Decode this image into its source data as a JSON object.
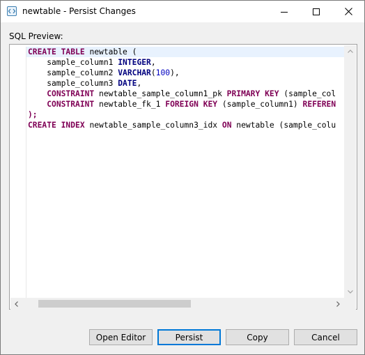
{
  "window": {
    "title": "newtable - Persist Changes"
  },
  "preview": {
    "label": "SQL Preview:"
  },
  "sql_lines": [
    [
      {
        "t": "CREATE",
        "c": "kw"
      },
      {
        "t": " "
      },
      {
        "t": "TABLE",
        "c": "kw"
      },
      {
        "t": " newtable ("
      }
    ],
    [
      {
        "t": "    sample_column1 "
      },
      {
        "t": "INTEGER",
        "c": "kwb"
      },
      {
        "t": ","
      }
    ],
    [
      {
        "t": "    sample_column2 "
      },
      {
        "t": "VARCHAR",
        "c": "kwb"
      },
      {
        "t": "("
      },
      {
        "t": "100",
        "c": "num"
      },
      {
        "t": "),"
      }
    ],
    [
      {
        "t": "    sample_column3 "
      },
      {
        "t": "DATE",
        "c": "kwb"
      },
      {
        "t": ","
      }
    ],
    [
      {
        "t": "    "
      },
      {
        "t": "CONSTRAINT",
        "c": "kw"
      },
      {
        "t": " newtable_sample_column1_pk "
      },
      {
        "t": "PRIMARY",
        "c": "kw"
      },
      {
        "t": " "
      },
      {
        "t": "KEY",
        "c": "kw"
      },
      {
        "t": " (sample_col"
      }
    ],
    [
      {
        "t": "    "
      },
      {
        "t": "CONSTRAINT",
        "c": "kw"
      },
      {
        "t": " newtable_fk_1 "
      },
      {
        "t": "FOREIGN",
        "c": "kw"
      },
      {
        "t": " "
      },
      {
        "t": "KEY",
        "c": "kw"
      },
      {
        "t": " (sample_column1) "
      },
      {
        "t": "REFEREN",
        "c": "kw"
      }
    ],
    [
      {
        "t": ");",
        "c": "kw"
      }
    ],
    [
      {
        "t": "CREATE",
        "c": "kw"
      },
      {
        "t": " "
      },
      {
        "t": "INDEX",
        "c": "kw"
      },
      {
        "t": " newtable_sample_column3_idx "
      },
      {
        "t": "ON",
        "c": "kw"
      },
      {
        "t": " newtable (sample_colu"
      }
    ]
  ],
  "buttons": {
    "open_editor": "Open Editor",
    "persist": "Persist",
    "copy": "Copy",
    "cancel": "Cancel"
  }
}
